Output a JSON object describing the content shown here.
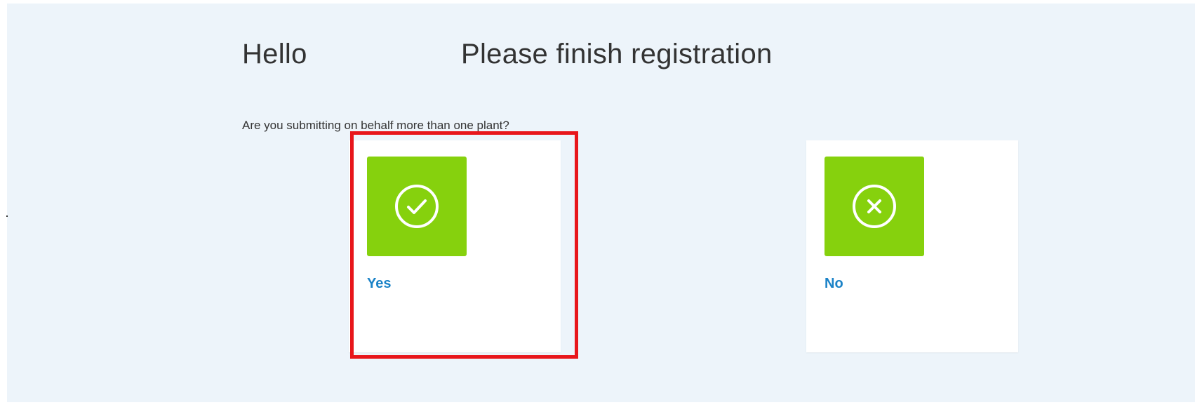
{
  "header": {
    "greeting": "Hello",
    "headline": "Please finish registration"
  },
  "question": {
    "text": "Are you submitting on behalf more than one plant?"
  },
  "options": [
    {
      "label": "Yes",
      "icon": "check-circle-icon"
    },
    {
      "label": "No",
      "icon": "x-circle-icon"
    }
  ],
  "colors": {
    "background": "#edf4fa",
    "tile": "#86d10d",
    "label": "#1a82c7",
    "highlight": "#e8161b"
  }
}
